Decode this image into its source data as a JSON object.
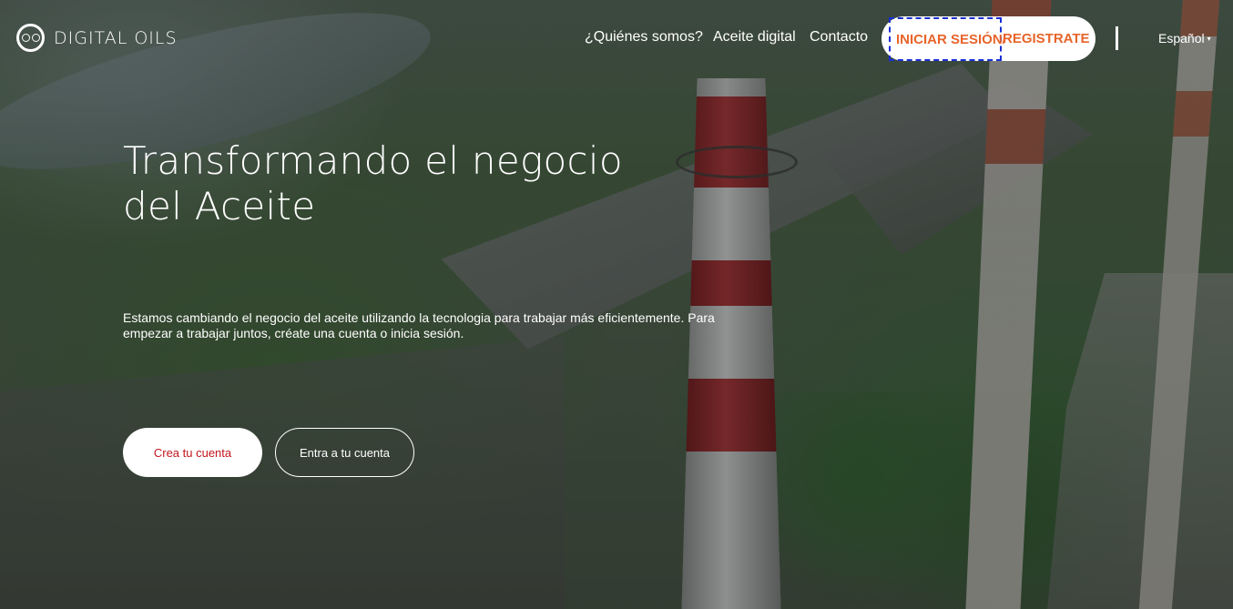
{
  "brand": {
    "name": "DIGITAL OILS"
  },
  "nav": {
    "items": [
      {
        "label": "¿Quiénes somos?"
      },
      {
        "label": "Aceite digital"
      },
      {
        "label": "Contacto"
      }
    ],
    "login_label": "INICIAR SESIÓN/",
    "register_label": "REGISTRATE",
    "language": "Español"
  },
  "hero": {
    "title": "Transformando el negocio del Aceite",
    "description": "Estamos cambiando el negocio del aceite utilizando la tecnologia para trabajar más eficientemente. Para empezar a trabajar juntos, créate una cuenta o inicia sesión.",
    "create_account_label": "Crea tu cuenta",
    "enter_account_label": "Entra a tu cuenta"
  },
  "colors": {
    "accent_orange": "#e8642a",
    "accent_red": "#c2161e",
    "focus_outline": "#1a2fd6"
  }
}
